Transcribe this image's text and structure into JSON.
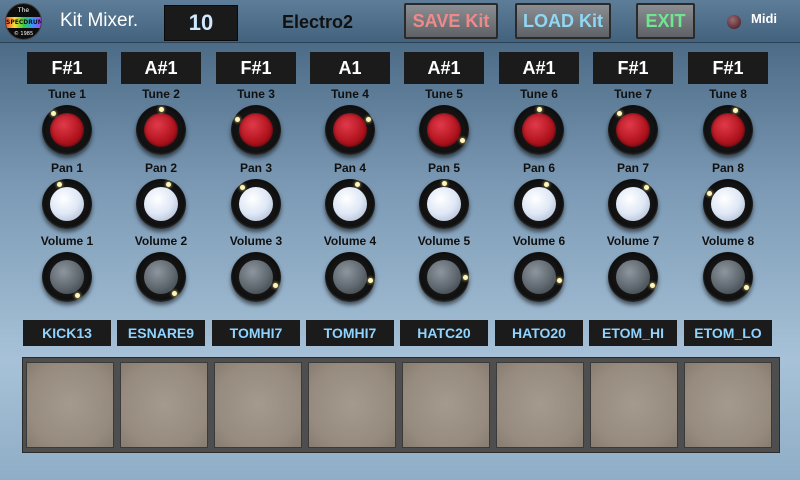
{
  "header": {
    "app_title": "Kit Mixer.",
    "kit_number": "10",
    "kit_name": "Electro2",
    "save_label": "SAVE Kit",
    "load_label": "LOAD Kit",
    "exit_label": "EXIT",
    "midi_label": "Midi"
  },
  "logo": {
    "line1": "The",
    "line2": "SPECDRUM",
    "line3": "© 1985"
  },
  "channels": [
    {
      "note": "F#1",
      "tune_label": "Tune 1",
      "pan_label": "Pan 1",
      "volume_label": "Volume 1",
      "sample": "KICK13"
    },
    {
      "note": "A#1",
      "tune_label": "Tune 2",
      "pan_label": "Pan 2",
      "volume_label": "Volume 2",
      "sample": "ESNARE9"
    },
    {
      "note": "F#1",
      "tune_label": "Tune 3",
      "pan_label": "Pan 3",
      "volume_label": "Volume 3",
      "sample": "TOMHI7"
    },
    {
      "note": "A1",
      "tune_label": "Tune 4",
      "pan_label": "Pan 4",
      "volume_label": "Volume 4",
      "sample": "TOMHI7"
    },
    {
      "note": "A#1",
      "tune_label": "Tune 5",
      "pan_label": "Pan 5",
      "volume_label": "Volume 5",
      "sample": "HATC20"
    },
    {
      "note": "A#1",
      "tune_label": "Tune 6",
      "pan_label": "Pan 6",
      "volume_label": "Volume 6",
      "sample": "HATO20"
    },
    {
      "note": "F#1",
      "tune_label": "Tune 7",
      "pan_label": "Pan 7",
      "volume_label": "Volume 7",
      "sample": "ETOM_HI"
    },
    {
      "note": "F#1",
      "tune_label": "Tune 8",
      "pan_label": "Pan 8",
      "volume_label": "Volume 8",
      "sample": "ETOM_LO"
    }
  ],
  "knob_angles_deg": {
    "tune": [
      -40,
      0,
      -60,
      60,
      120,
      0,
      -40,
      20
    ],
    "pan": [
      -20,
      20,
      -40,
      20,
      0,
      20,
      40,
      -60
    ],
    "volume": [
      150,
      140,
      115,
      100,
      90,
      100,
      115,
      120
    ]
  }
}
